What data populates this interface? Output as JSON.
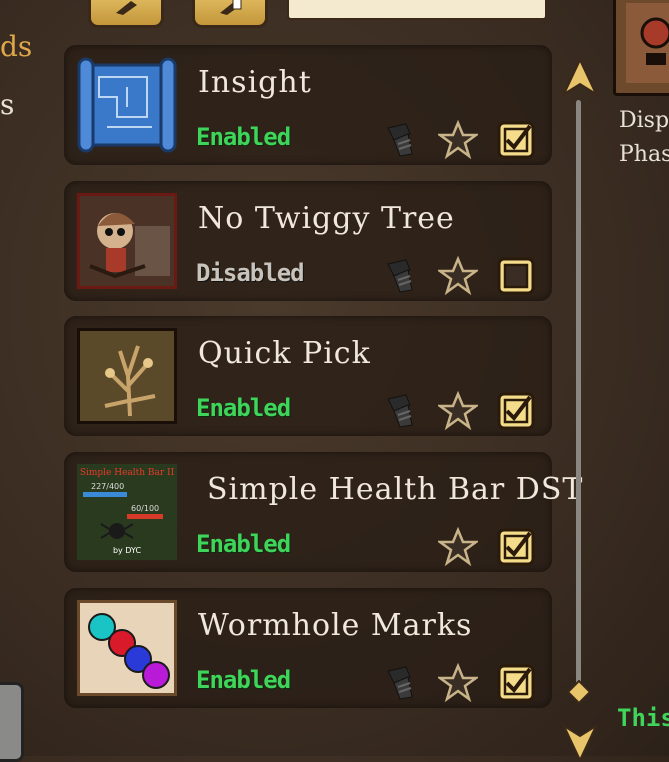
{
  "left_panel": {
    "text_1": "ds",
    "text_2": "s"
  },
  "right_panel": {
    "line_1": "Disp",
    "line_2": "Phas",
    "bottom_text": "This"
  },
  "mods": [
    {
      "title": "Insight",
      "status": "Enabled",
      "enabled": true,
      "has_config": true,
      "thumb": "blueprint-scroll-icon"
    },
    {
      "title": "No Twiggy Tree",
      "status": "Disabled",
      "enabled": false,
      "has_config": true,
      "thumb": "girl-character-art"
    },
    {
      "title": "Quick Pick",
      "status": "Enabled",
      "enabled": true,
      "has_config": true,
      "thumb": "twig-bush-art"
    },
    {
      "title": "Simple Health Bar DST",
      "status": "Enabled",
      "enabled": true,
      "has_config": false,
      "thumb": "health-bar-preview",
      "thumb_text": {
        "header": "Simple Health Bar II",
        "hp1": "227/400",
        "hp2": "60/100",
        "footer": "by DYC"
      }
    },
    {
      "title": "Wormhole Marks",
      "status": "Enabled",
      "enabled": true,
      "has_config": true,
      "thumb": "colored-orbs-art"
    }
  ],
  "colors": {
    "enabled": "#3fd45a",
    "disabled": "#c9c4bb",
    "accent_gold": "#e8c46a"
  }
}
